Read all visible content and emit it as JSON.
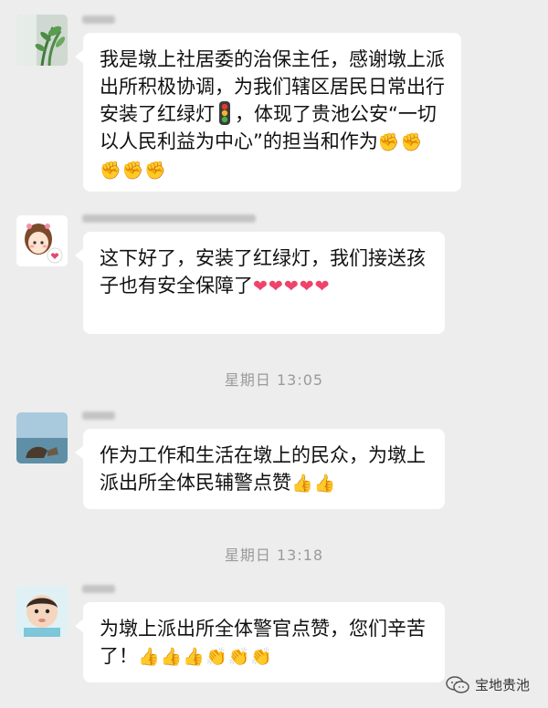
{
  "messages": [
    {
      "text": "我是墩上社居委的治保主任，感谢墩上派出所积极协调，为我们辖区居民日常出行安装了红绿灯",
      "text2": "，体现了贵池公安“一切以人民利益为中心”的担当和作为",
      "emoji_icon": "traffic-light",
      "trailing_emoji": "✊✊✊✊✊"
    },
    {
      "text": "这下好了，安装了红绿灯，我们接送孩子也有安全保障了",
      "trailing_emoji": "❤❤❤❤❤"
    },
    {
      "text": "作为工作和生活在墩上的民众，为墩上派出所全体民辅警点赞",
      "trailing_emoji": "👍👍"
    },
    {
      "text": "为墩上派出所全体警官点赞，您们辛苦了！",
      "trailing_emoji_a": "👍👍👍",
      "trailing_emoji_b": "👏👏👏"
    }
  ],
  "timestamps": [
    "星期日 13:05",
    "星期日 13:18"
  ],
  "watermark": {
    "label": "宝地贵池"
  },
  "colors": {
    "background": "#ededed",
    "bubble": "#ffffff",
    "timestamp": "#9a9a9a"
  }
}
